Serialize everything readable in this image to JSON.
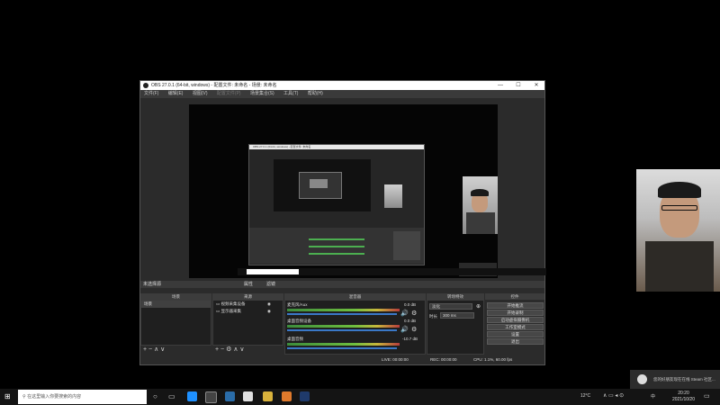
{
  "window": {
    "title": "OBS 27.0.1 (64-bit, windows) - 配置文件: 未命名 - 场景: 未命名",
    "min": "—",
    "max": "☐",
    "close": "✕"
  },
  "menu": [
    "文件(F)",
    "编辑(E)",
    "视图(V)",
    "配置文件(P)",
    "场景集合(S)",
    "工具(T)",
    "帮助(H)"
  ],
  "dock_bar": {
    "label": "未选择源",
    "properties": "属性",
    "filters": "滤镜"
  },
  "docks": {
    "scenes": {
      "title": "场景",
      "items": [
        "场景"
      ]
    },
    "sources": {
      "title": "来源",
      "items": [
        "视频采集设备",
        "显示器采集"
      ]
    },
    "mixer": {
      "title": "混音器",
      "channels": [
        {
          "name": "麦克风/Aux",
          "db": "0.0 dB"
        },
        {
          "name": "桌面音频设备",
          "db": "0.0 dB"
        },
        {
          "name": "桌面音频",
          "db": "-10.7 dB"
        }
      ]
    },
    "transitions": {
      "title": "转场特效",
      "type": "淡化",
      "duration_label": "时长",
      "duration": "300 ms"
    },
    "controls": {
      "title": "控件",
      "buttons": [
        "开始推流",
        "开始录制",
        "启动虚拟摄像机",
        "工作室模式",
        "设置",
        "退出"
      ]
    }
  },
  "status": {
    "live": "LIVE: 00:00:00",
    "rec": "REC: 00:00:00",
    "cpu": "CPU: 1.1%, 60.00 fps"
  },
  "nested": {
    "caption": "OBS 27.0.1 (64-bit, windows) - 配置文件: 未命名"
  },
  "notification": {
    "text": "您的好朋友现在在线 Steam 社区..."
  },
  "taskbar": {
    "search_placeholder": "在这里输入你要搜索的内容",
    "temp": "12°C",
    "ime": "中",
    "time": "20:20",
    "date": "2021/10/20"
  }
}
